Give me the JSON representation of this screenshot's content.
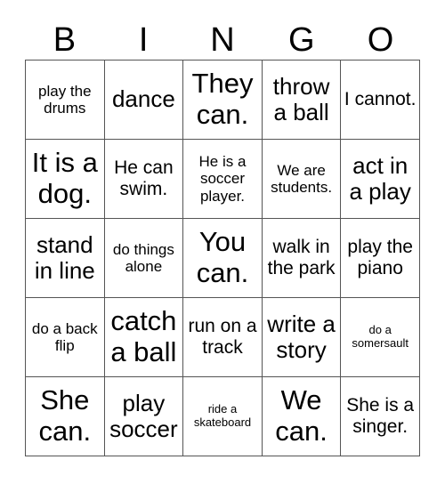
{
  "header": {
    "letters": [
      "B",
      "I",
      "N",
      "G",
      "O"
    ]
  },
  "grid": {
    "columns": 5,
    "rows": 5,
    "cells": [
      {
        "text": "play the drums",
        "size": "sm"
      },
      {
        "text": "dance",
        "size": "lg"
      },
      {
        "text": "They can.",
        "size": "xl"
      },
      {
        "text": "throw a ball",
        "size": "lg"
      },
      {
        "text": "I cannot.",
        "size": "md"
      },
      {
        "text": "It is a dog.",
        "size": "xl"
      },
      {
        "text": "He can swim.",
        "size": "md"
      },
      {
        "text": "He is a soccer player.",
        "size": "sm"
      },
      {
        "text": "We are students.",
        "size": "sm"
      },
      {
        "text": "act in a play",
        "size": "lg"
      },
      {
        "text": "stand in line",
        "size": "lg"
      },
      {
        "text": "do things alone",
        "size": "sm"
      },
      {
        "text": "You can.",
        "size": "xl"
      },
      {
        "text": "walk in the park",
        "size": "md"
      },
      {
        "text": "play the piano",
        "size": "md"
      },
      {
        "text": "do a back flip",
        "size": "sm"
      },
      {
        "text": "catch a ball",
        "size": "xl"
      },
      {
        "text": "run on a track",
        "size": "md"
      },
      {
        "text": "write a story",
        "size": "lg"
      },
      {
        "text": "do a somersault",
        "size": "xs"
      },
      {
        "text": "She can.",
        "size": "xl"
      },
      {
        "text": "play soccer",
        "size": "lg"
      },
      {
        "text": "ride a skateboard",
        "size": "xs"
      },
      {
        "text": "We can.",
        "size": "xl"
      },
      {
        "text": "She is a singer.",
        "size": "md"
      }
    ]
  },
  "colors": {
    "grid_line": "#555555",
    "text": "#000000",
    "background": "#ffffff"
  }
}
